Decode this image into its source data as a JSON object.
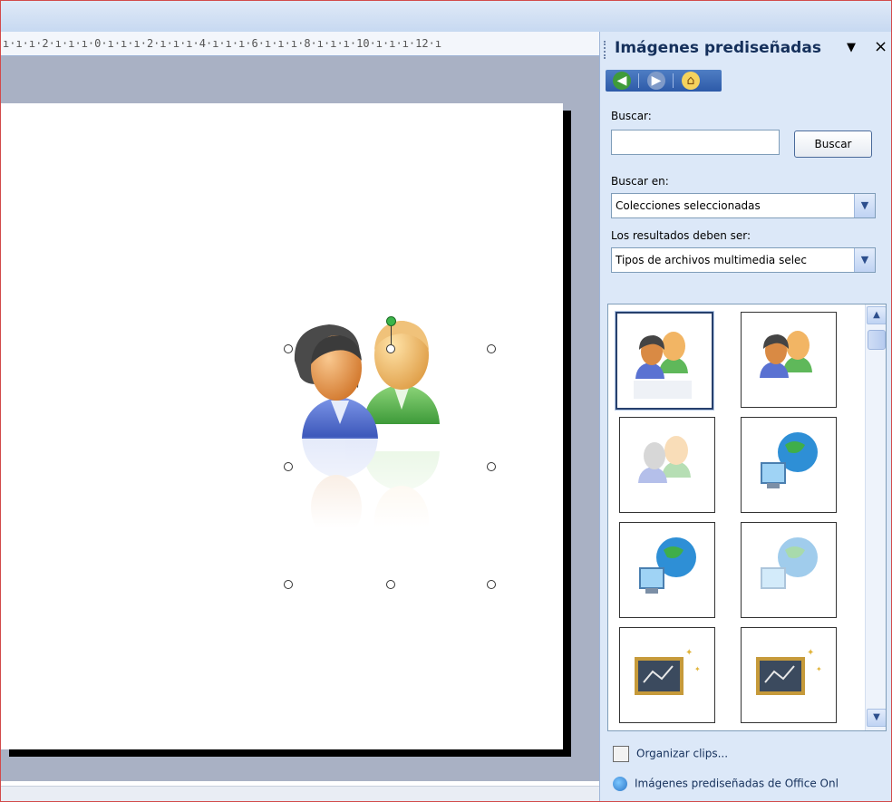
{
  "ruler": {
    "text": "ı·ı·ı·2·ı·ı·ı·0·ı·ı·ı·2·ı·ı·ı·4·ı·ı·ı·6·ı·ı·ı·8·ı·ı·ı·10·ı·ı·ı·12·ı"
  },
  "task_pane": {
    "title": "Imágenes prediseñadas",
    "menu_glyph": "▼",
    "close_glyph": "×",
    "nav": {
      "back_glyph": "◀",
      "forward_glyph": "▶",
      "home_glyph": "⌂"
    },
    "search": {
      "label": "Buscar:",
      "value": "",
      "button_label": "Buscar"
    },
    "search_in": {
      "label": "Buscar en:",
      "selected": "Colecciones seleccionadas"
    },
    "results": {
      "label": "Los resultados deben ser:",
      "selected": "Tipos de archivos multimedia selec"
    },
    "dropdown_glyph": "▼",
    "gallery_items": [
      {
        "icon": "people-icon"
      },
      {
        "icon": "people-icon"
      },
      {
        "icon": "people-faded-icon"
      },
      {
        "icon": "globe-computer-icon"
      },
      {
        "icon": "globe-computer-icon"
      },
      {
        "icon": "globe-computer-faded-icon"
      },
      {
        "icon": "chalkboard-icon"
      },
      {
        "icon": "chalkboard-icon"
      }
    ],
    "scroll_up_glyph": "▲",
    "scroll_down_glyph": "▼",
    "links": {
      "organize": "Organizar clips...",
      "office_online": "Imágenes prediseñadas de Office Onl"
    }
  },
  "slide": {
    "selected_clip": "people-icon"
  },
  "colors": {
    "selection_handle": "#ffffff",
    "rotate_handle": "#3bb54a",
    "pane_background": "#dce8f8",
    "nav_bar": "#2d5aa8"
  }
}
